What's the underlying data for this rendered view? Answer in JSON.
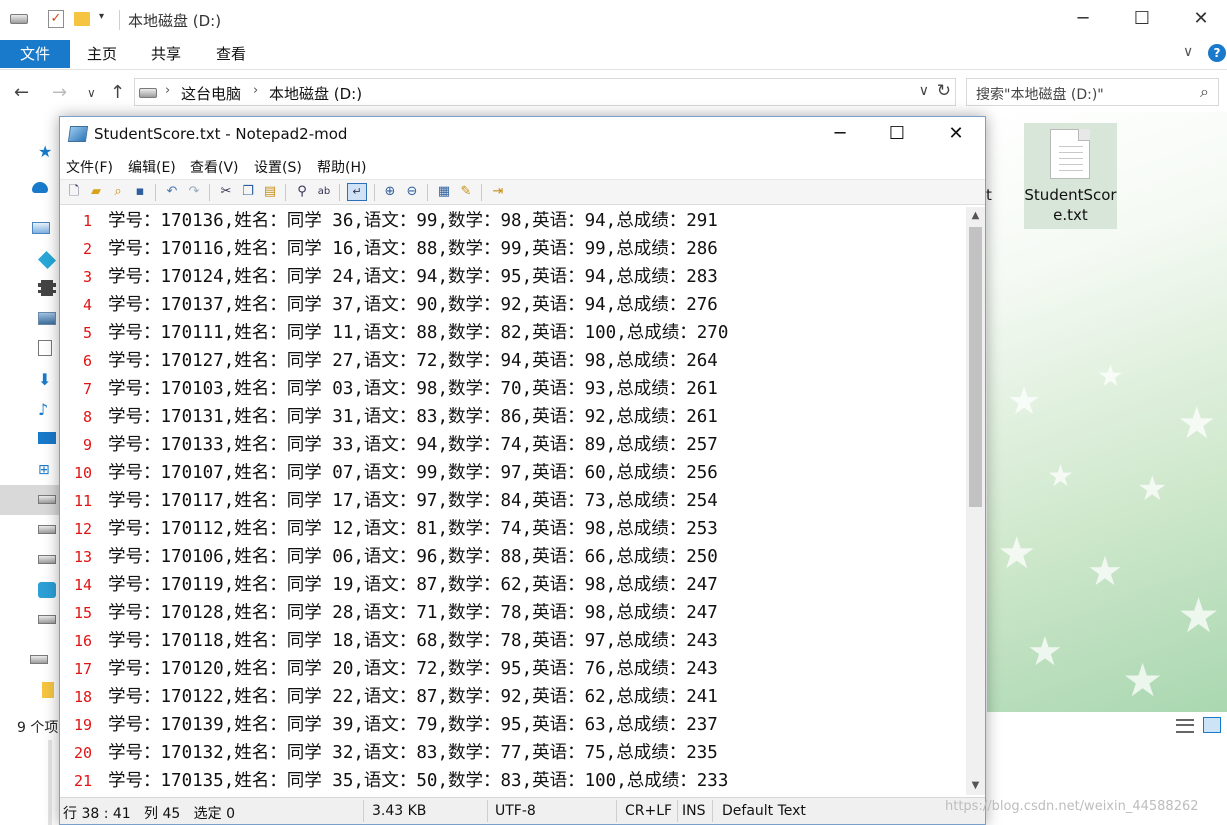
{
  "explorer": {
    "title": "本地磁盘 (D:)",
    "ribbon_tabs": {
      "file": "文件",
      "home": "主页",
      "share": "共享",
      "view": "查看"
    },
    "help_glyph": "?",
    "address": {
      "crumb1": "这台电脑",
      "crumb2": "本地磁盘 (D:)"
    },
    "search_placeholder": "搜索\"本地磁盘 (D:)\"",
    "file_item_name": "StudentScore.txt",
    "partial_label": "t",
    "status_count": "9 个项",
    "accent_color": "#1979ca"
  },
  "notepad": {
    "title": "StudentScore.txt - Notepad2-mod",
    "menu": {
      "file": "文件(F)",
      "edit": "编辑(E)",
      "view": "查看(V)",
      "settings": "设置(S)",
      "help": "帮助(H)"
    },
    "lines": [
      {
        "num": "1",
        "text": "学号：170136,姓名：同学 36,语文：99,数学：98,英语：94,总成绩：291"
      },
      {
        "num": "2",
        "text": "学号：170116,姓名：同学 16,语文：88,数学：99,英语：99,总成绩：286"
      },
      {
        "num": "3",
        "text": "学号：170124,姓名：同学 24,语文：94,数学：95,英语：94,总成绩：283"
      },
      {
        "num": "4",
        "text": "学号：170137,姓名：同学 37,语文：90,数学：92,英语：94,总成绩：276"
      },
      {
        "num": "5",
        "text": "学号：170111,姓名：同学 11,语文：88,数学：82,英语：100,总成绩：270"
      },
      {
        "num": "6",
        "text": "学号：170127,姓名：同学 27,语文：72,数学：94,英语：98,总成绩：264"
      },
      {
        "num": "7",
        "text": "学号：170103,姓名：同学 03,语文：98,数学：70,英语：93,总成绩：261"
      },
      {
        "num": "8",
        "text": "学号：170131,姓名：同学 31,语文：83,数学：86,英语：92,总成绩：261"
      },
      {
        "num": "9",
        "text": "学号：170133,姓名：同学 33,语文：94,数学：74,英语：89,总成绩：257"
      },
      {
        "num": "10",
        "text": "学号：170107,姓名：同学 07,语文：99,数学：97,英语：60,总成绩：256"
      },
      {
        "num": "11",
        "text": "学号：170117,姓名：同学 17,语文：97,数学：84,英语：73,总成绩：254"
      },
      {
        "num": "12",
        "text": "学号：170112,姓名：同学 12,语文：81,数学：74,英语：98,总成绩：253"
      },
      {
        "num": "13",
        "text": "学号：170106,姓名：同学 06,语文：96,数学：88,英语：66,总成绩：250"
      },
      {
        "num": "14",
        "text": "学号：170119,姓名：同学 19,语文：87,数学：62,英语：98,总成绩：247"
      },
      {
        "num": "15",
        "text": "学号：170128,姓名：同学 28,语文：71,数学：78,英语：98,总成绩：247"
      },
      {
        "num": "16",
        "text": "学号：170118,姓名：同学 18,语文：68,数学：78,英语：97,总成绩：243"
      },
      {
        "num": "17",
        "text": "学号：170120,姓名：同学 20,语文：72,数学：95,英语：76,总成绩：243"
      },
      {
        "num": "18",
        "text": "学号：170122,姓名：同学 22,语文：87,数学：92,英语：62,总成绩：241"
      },
      {
        "num": "19",
        "text": "学号：170139,姓名：同学 39,语文：79,数学：95,英语：63,总成绩：237"
      },
      {
        "num": "20",
        "text": "学号：170132,姓名：同学 32,语文：83,数学：77,英语：75,总成绩：235"
      },
      {
        "num": "21",
        "text": "学号：170135,姓名：同学 35,语文：50,数学：83,英语：100,总成绩：233"
      }
    ],
    "status": {
      "position": "行 38 : 41   列 45   选定 0",
      "size": "3.43 KB",
      "encoding": "UTF-8",
      "eol": "CR+LF",
      "ins": "INS",
      "scheme": "Default Text"
    },
    "line_number_color": "#e01414"
  },
  "watermark": "https://blog.csdn.net/weixin_44588262"
}
